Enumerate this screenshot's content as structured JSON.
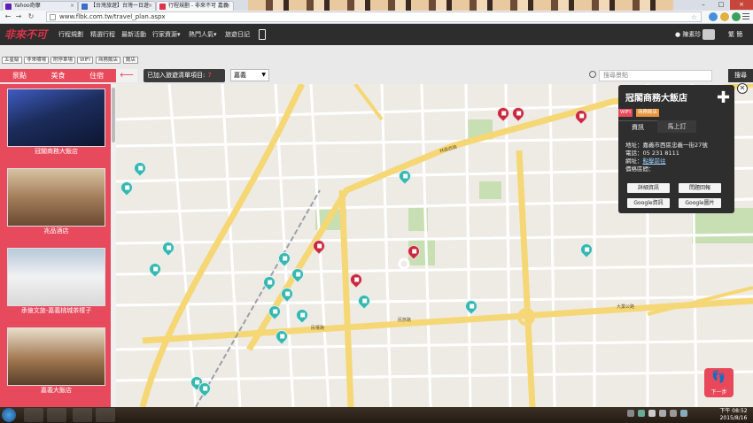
{
  "browser": {
    "tabs": [
      {
        "label": "Yahoo奇摩",
        "favicon_color": "#5f1dbd"
      },
      {
        "label": "【台灣旅遊】台灣一日遊",
        "favicon_color": "#3b6ec5"
      },
      {
        "label": "行程規劃 - 非來不可 嘉義",
        "favicon_color": "#e0334a"
      }
    ],
    "url": "www.flbk.com.tw/travel_plan.aspx"
  },
  "header": {
    "logo": "非來不可",
    "nav": [
      "行程規劃",
      "精選行程",
      "最新活動",
      "行家資源▾",
      "熱門人氣▾",
      "旅遊日記"
    ],
    "user_name": "陳素珍",
    "lang": "繁 簡"
  },
  "filters": {
    "tags": [
      "五星級",
      "非來嘯場",
      "附停車場",
      "WIFI",
      "商務飯店",
      "飯店"
    ],
    "categories": [
      "景點",
      "美食",
      "住宿"
    ],
    "added_label": "已加入旅遊清單項目:",
    "added_count": "7",
    "city_select": "嘉義",
    "search_placeholder": "搜尋景點",
    "search_button": "搜尋"
  },
  "hotels": [
    {
      "name": "冠閣商務大飯店",
      "photo_a": "#1c2d5c",
      "photo_b": "#6a7bb6"
    },
    {
      "name": "兆品酒店",
      "photo_a": "#6a4a33",
      "photo_b": "#d8c2a2"
    },
    {
      "name": "承億文旅-嘉義桃城茶樣子",
      "photo_a": "#b7c9d8",
      "photo_b": "#f2f2f2"
    },
    {
      "name": "嘉義大飯店",
      "photo_a": "#5a3e2a",
      "photo_b": "#e8dcc8"
    }
  ],
  "panel": {
    "title": "冠閣商務大飯店",
    "tags": [
      {
        "label": "WIFI",
        "color": "#e84a5c"
      },
      {
        "label": "商務飯店",
        "color": "#e8943a"
      }
    ],
    "tab_info": "資訊",
    "tab_book": "馬上訂",
    "address": "地址：嘉義市西區忠義一街27號",
    "phone": "電話：05 231 8111",
    "website_label": "網址：",
    "website_link": "點擊前往",
    "price_label": "價格區間：",
    "buttons": [
      "詳細資訊",
      "問題回報",
      "Google資訊",
      "Google圖片"
    ]
  },
  "next_button": "下一步",
  "map": {
    "labels": [
      "嘉義市",
      "林森西路",
      "大雅路",
      "民族路",
      "民權路",
      "大業公路",
      "南京路",
      "中山路"
    ]
  },
  "taskbar": {
    "time": "下午 08:52",
    "date": "2015/8/16"
  }
}
